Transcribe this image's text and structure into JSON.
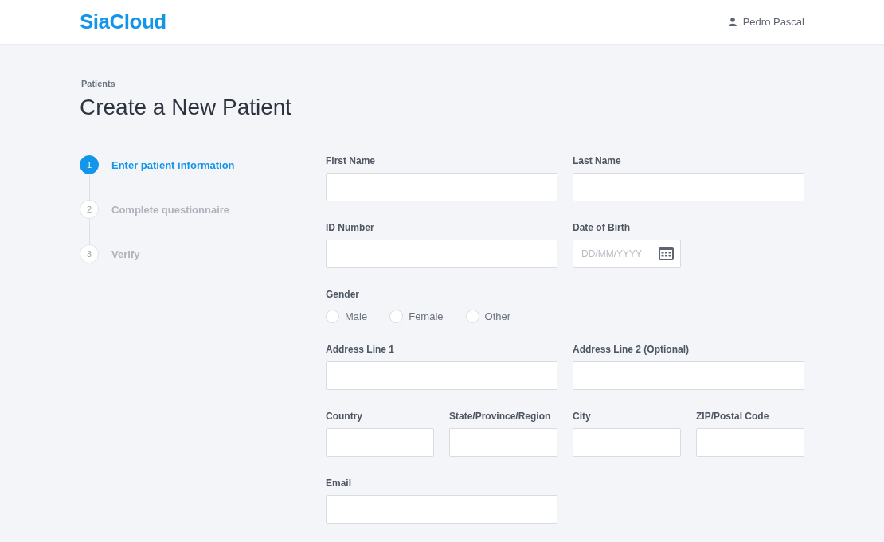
{
  "header": {
    "logo": "SiaCloud",
    "user": "Pedro Pascal"
  },
  "breadcrumb": "Patients",
  "title": "Create a New Patient",
  "steps": [
    {
      "number": "1",
      "label": "Enter patient information",
      "selected": true
    },
    {
      "number": "2",
      "label": "Complete questionnaire",
      "selected": false
    },
    {
      "number": "3",
      "label": "Verify",
      "selected": false
    }
  ],
  "form": {
    "rows": [
      {
        "fields": [
          {
            "kind": "text",
            "label": "First Name"
          },
          {
            "kind": "text",
            "label": "Last Name"
          }
        ]
      },
      {
        "fields": [
          {
            "kind": "text",
            "label": "ID Number"
          },
          {
            "kind": "date",
            "label": "Date of Birth",
            "placeholder": "DD/MM/YYYY"
          }
        ]
      },
      {
        "fields": [
          {
            "kind": "radio",
            "label": "Gender",
            "options": [
              {
                "label": "Male",
                "selected": false
              },
              {
                "label": "Female",
                "selected": false
              },
              {
                "label": "Other",
                "selected": false
              }
            ]
          }
        ]
      },
      {
        "fields": [
          {
            "kind": "text",
            "label": "Address Line 1"
          },
          {
            "kind": "text",
            "label": "Address Line 2 (Optional)"
          }
        ]
      },
      {
        "fields": [
          {
            "kind": "short",
            "label": "Country"
          },
          {
            "kind": "short",
            "label": "State/Province/Region"
          },
          {
            "kind": "short",
            "label": "City"
          },
          {
            "kind": "short",
            "label": "ZIP/Postal Code"
          }
        ]
      },
      {
        "fields": [
          {
            "kind": "text",
            "label": "Email"
          }
        ]
      }
    ]
  }
}
